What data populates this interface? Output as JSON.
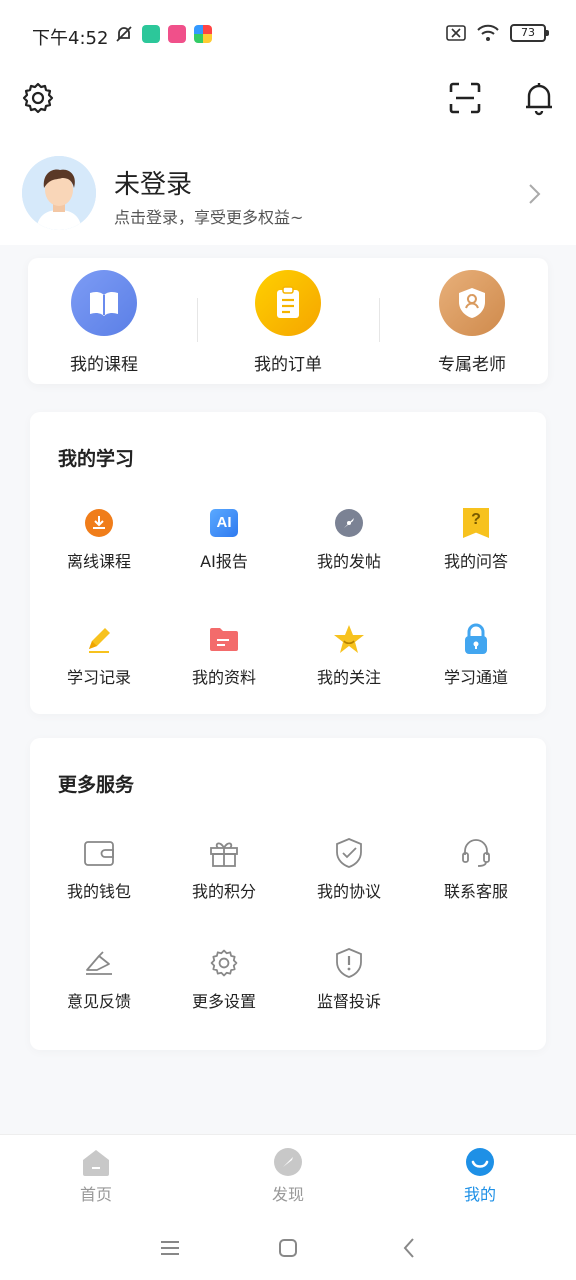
{
  "status_bar": {
    "time": "下午4:52",
    "battery": "73",
    "icons": [
      "bell-muted-icon",
      "app-shield-icon",
      "app-pink-icon",
      "app-pinwheel-icon",
      "sim-x-icon",
      "wifi-icon",
      "battery-icon"
    ]
  },
  "header": {
    "icons": [
      "settings-icon",
      "scan-icon",
      "bell-icon"
    ]
  },
  "profile": {
    "title": "未登录",
    "subtitle": "点击登录，享受更多权益~"
  },
  "quick": [
    {
      "label": "我的课程",
      "icon": "book-icon",
      "color": "#6f8ff0"
    },
    {
      "label": "我的订单",
      "icon": "clipboard-icon",
      "color": "#f5b400"
    },
    {
      "label": "专属老师",
      "icon": "teacher-shield-icon",
      "color": "#d99a5e"
    }
  ],
  "study": {
    "title": "我的学习",
    "items": [
      {
        "label": "离线课程",
        "icon": "download-icon"
      },
      {
        "label": "AI报告",
        "icon": "ai-icon",
        "text": "AI"
      },
      {
        "label": "我的发帖",
        "icon": "compass-icon"
      },
      {
        "label": "我的问答",
        "icon": "question-icon",
        "text": "?"
      },
      {
        "label": "学习记录",
        "icon": "pencil-icon"
      },
      {
        "label": "我的资料",
        "icon": "folder-icon"
      },
      {
        "label": "我的关注",
        "icon": "star-icon"
      },
      {
        "label": "学习通道",
        "icon": "lock-icon"
      }
    ]
  },
  "services": {
    "title": "更多服务",
    "items": [
      {
        "label": "我的钱包",
        "icon": "wallet-icon"
      },
      {
        "label": "我的积分",
        "icon": "gift-icon"
      },
      {
        "label": "我的协议",
        "icon": "shield-check-icon"
      },
      {
        "label": "联系客服",
        "icon": "headset-icon"
      },
      {
        "label": "意见反馈",
        "icon": "feedback-icon"
      },
      {
        "label": "更多设置",
        "icon": "gear-icon"
      },
      {
        "label": "监督投诉",
        "icon": "alert-shield-icon"
      }
    ]
  },
  "bottom_nav": [
    {
      "label": "首页",
      "icon": "home-icon",
      "active": false
    },
    {
      "label": "发现",
      "icon": "discover-icon",
      "active": false
    },
    {
      "label": "我的",
      "icon": "profile-smile-icon",
      "active": true
    }
  ],
  "colors": {
    "accent": "#1e90e6",
    "download_orange": "#f07d1a",
    "ai_blue": "#2f8cf0",
    "question_yellow": "#f7c21e",
    "folder_red": "#f36b6b",
    "lock_blue": "#42a6f0"
  }
}
